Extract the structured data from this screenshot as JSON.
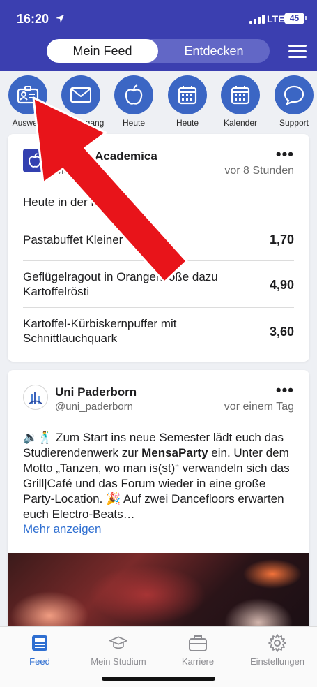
{
  "status_bar": {
    "time": "16:20",
    "network": "LTE",
    "battery": "45"
  },
  "header": {
    "tabs": [
      {
        "label": "Mein Feed",
        "active": true
      },
      {
        "label": "Entdecken",
        "active": false
      }
    ],
    "menu_icon": "hamburger-icon"
  },
  "quick_actions": [
    {
      "label": "Ausweis",
      "icon": "id-card-icon"
    },
    {
      "label": "Posteingang",
      "icon": "mail-icon"
    },
    {
      "label": "Heute",
      "icon": "apple-icon"
    },
    {
      "label": "Heute",
      "icon": "calendar-icon"
    },
    {
      "label": "Kalender",
      "icon": "calendar-icon"
    },
    {
      "label": "Support",
      "icon": "chat-bubble-icon"
    }
  ],
  "card1": {
    "title": "Mensa Academica",
    "handle": "Mensa",
    "time": "vor 8 Stunden",
    "heading": "Heute in der Mensa:",
    "items": [
      {
        "name": "Pastabuffet Kleiner Teller",
        "price": "1,70"
      },
      {
        "name": "Geflügelragout in Orangensoße dazu Kartoffelrösti",
        "price": "4,90"
      },
      {
        "name": "Kartoffel-Kürbiskernpuffer mit Schnittlauchquark",
        "price": "3,60"
      }
    ]
  },
  "card2": {
    "title": "Uni Paderborn",
    "handle": "@uni_paderborn",
    "time": "vor einem Tag",
    "text_before_bold": "🔉🕺 Zum Start ins neue Semester lädt euch das Studierendenwerk zur ",
    "text_bold": "MensaParty",
    "text_after_bold": " ein. Unter dem Motto „Tanzen, wo man is(st)“ verwandeln sich das Grill|Café und das Forum wieder in eine große Party-Location. 🎉 Auf zwei Dancefloors erwarten euch Electro-Beats…",
    "more_label": "Mehr anzeigen"
  },
  "tabbar": {
    "items": [
      {
        "label": "Feed",
        "icon": "feed-icon",
        "active": true
      },
      {
        "label": "Mein Studium",
        "icon": "graduation-cap-icon",
        "active": false
      },
      {
        "label": "Karriere",
        "icon": "briefcase-icon",
        "active": false
      },
      {
        "label": "Einstellungen",
        "icon": "gear-icon",
        "active": false
      }
    ]
  },
  "colors": {
    "header": "#3b3fb0",
    "accent": "#2f6fd1",
    "quick_action": "#3b66c4",
    "arrow": "#e8141a"
  }
}
